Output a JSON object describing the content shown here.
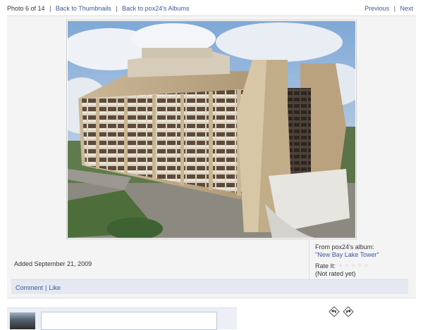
{
  "nav": {
    "photo_position": "Photo 6 of 14",
    "back_to_thumbnails": "Back to Thumbnails",
    "back_to_albums": "Back to pox24's Albums",
    "previous": "Previous",
    "next": "Next",
    "separator": "|"
  },
  "photo": {
    "alt": "Photo"
  },
  "meta": {
    "added": "Added September 21, 2009",
    "from_label": "From pox24's album:",
    "album_name": "\"New Bay Lake Tower\"",
    "rate_label": "Rate It:",
    "rating_stars": "★★★★★",
    "rating_status": "(Not rated yet)"
  },
  "actions": {
    "comment": "Comment",
    "like": "Like",
    "separator": "|"
  },
  "composer": {
    "placeholder": ""
  },
  "colors": {
    "link": "#3b5998",
    "panel": "#f4f4f4",
    "action_bar": "#e4e8f1"
  }
}
